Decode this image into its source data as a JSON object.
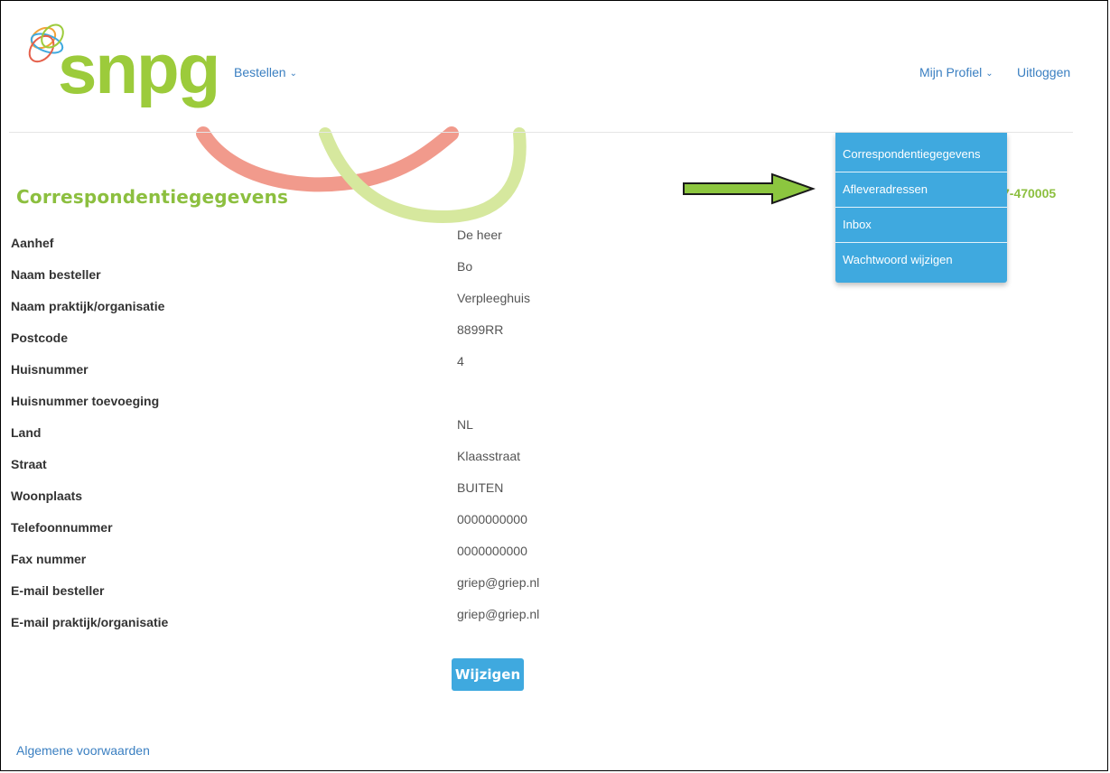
{
  "brand": {
    "logo_text": "snpg"
  },
  "nav": {
    "bestellen": "Bestellen",
    "mijn_profiel": "Mijn Profiel",
    "uitloggen": "Uitloggen"
  },
  "page": {
    "title": "Correspondentiegegevens",
    "phone_partial": "7-470005"
  },
  "fields": [
    {
      "label": "Aanhef",
      "value": " De heer"
    },
    {
      "label": "Naam besteller",
      "value": "Bo"
    },
    {
      "label": "Naam praktijk/organisatie",
      "value": "Verpleeghuis"
    },
    {
      "label": "Postcode",
      "value": "8899RR"
    },
    {
      "label": "Huisnummer",
      "value": "4"
    },
    {
      "label": "Huisnummer toevoeging",
      "value": ""
    },
    {
      "label": "Land",
      "value": "NL"
    },
    {
      "label": "Straat",
      "value": "Klaasstraat"
    },
    {
      "label": "Woonplaats",
      "value": "BUITEN"
    },
    {
      "label": "Telefoonnummer",
      "value": "0000000000"
    },
    {
      "label": "Fax nummer",
      "value": "0000000000"
    },
    {
      "label": "E-mail besteller",
      "value": "griep@griep.nl"
    },
    {
      "label": "E-mail praktijk/organisatie",
      "value": "griep@griep.nl"
    }
  ],
  "buttons": {
    "wijzigen": "Wijzigen"
  },
  "footer": {
    "terms": "Algemene voorwaarden"
  },
  "dropdown": {
    "items": [
      {
        "label": "Correspondentiegegevens"
      },
      {
        "label": "Afleveradressen"
      },
      {
        "label": "Inbox"
      },
      {
        "label": "Wachtwoord wijzigen"
      }
    ]
  },
  "icons": {
    "chevron": "chevron-down-icon",
    "annotation": "green-arrow-icon"
  },
  "colors": {
    "brand_green": "#9ccb3b",
    "link_blue": "#3a7fc1",
    "dropdown_blue": "#3fa9df",
    "arrow_green": "#8cc63f"
  }
}
